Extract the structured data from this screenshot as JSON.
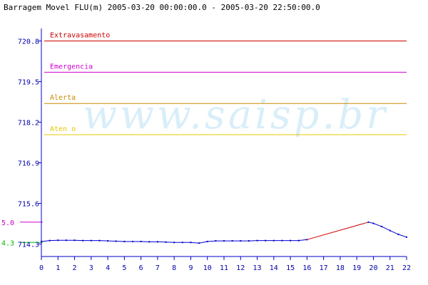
{
  "chart_data": {
    "type": "line",
    "title": "Barragem Movel FLU(m) 2005-03-20 00:00:00.0 - 2005-03-20 22:50:00.0",
    "watermark": "www.saisp.br",
    "xlim": [
      0,
      22
    ],
    "ylim": [
      713.9,
      721.2
    ],
    "x_ticks": [
      "0",
      "1",
      "2",
      "3",
      "4",
      "5",
      "6",
      "7",
      "8",
      "9",
      "10",
      "11",
      "12",
      "13",
      "14",
      "15",
      "16",
      "17",
      "18",
      "19",
      "20",
      "21",
      "22"
    ],
    "y_ticks": [
      "720.8",
      "719.5",
      "718.2",
      "716.9",
      "715.6",
      "714.3"
    ],
    "y_tick_values": [
      720.8,
      719.5,
      718.2,
      716.9,
      715.6,
      714.3
    ],
    "thresholds": [
      {
        "name": "Extravasamento",
        "value": 720.8,
        "color": "#cc0000"
      },
      {
        "name": "Emergencia",
        "value": 719.8,
        "color": "#cc00cc"
      },
      {
        "name": "Alerta",
        "value": 718.8,
        "color": "#cc8800"
      },
      {
        "name": "Aten  o",
        "value": 717.8,
        "color": "#e8c800"
      }
    ],
    "side_markers": [
      {
        "label": "5.0",
        "value": 715.0,
        "color": "#cc00cc"
      },
      {
        "label": "4.3",
        "value": 714.35,
        "color": "#00bb00"
      }
    ],
    "series": [
      {
        "color": "#0000cc",
        "x": [
          0,
          0.5,
          1,
          1.5,
          2,
          2.5,
          3,
          3.5,
          4,
          4.5,
          5,
          5.5,
          6,
          6.5,
          7,
          7.5,
          8,
          8.5,
          9,
          9.5,
          10,
          10.5,
          11,
          11.5,
          12,
          12.5,
          13,
          13.5,
          14,
          14.5,
          15,
          15.5,
          16
        ],
        "values": [
          714.38,
          714.41,
          714.42,
          714.42,
          714.42,
          714.41,
          714.41,
          714.41,
          714.4,
          714.39,
          714.38,
          714.38,
          714.38,
          714.37,
          714.37,
          714.36,
          714.35,
          714.35,
          714.35,
          714.33,
          714.38,
          714.4,
          714.4,
          714.4,
          714.4,
          714.4,
          714.41,
          714.41,
          714.41,
          714.41,
          714.41,
          714.41,
          714.44
        ]
      },
      {
        "color": "#cc0000",
        "x": [
          16,
          19.7
        ],
        "values": [
          714.44,
          715.0
        ]
      },
      {
        "color": "#0000cc",
        "x": [
          19.7,
          20,
          20.5,
          21,
          21.5,
          22
        ],
        "values": [
          715.0,
          714.96,
          714.86,
          714.73,
          714.61,
          714.52
        ]
      }
    ]
  }
}
